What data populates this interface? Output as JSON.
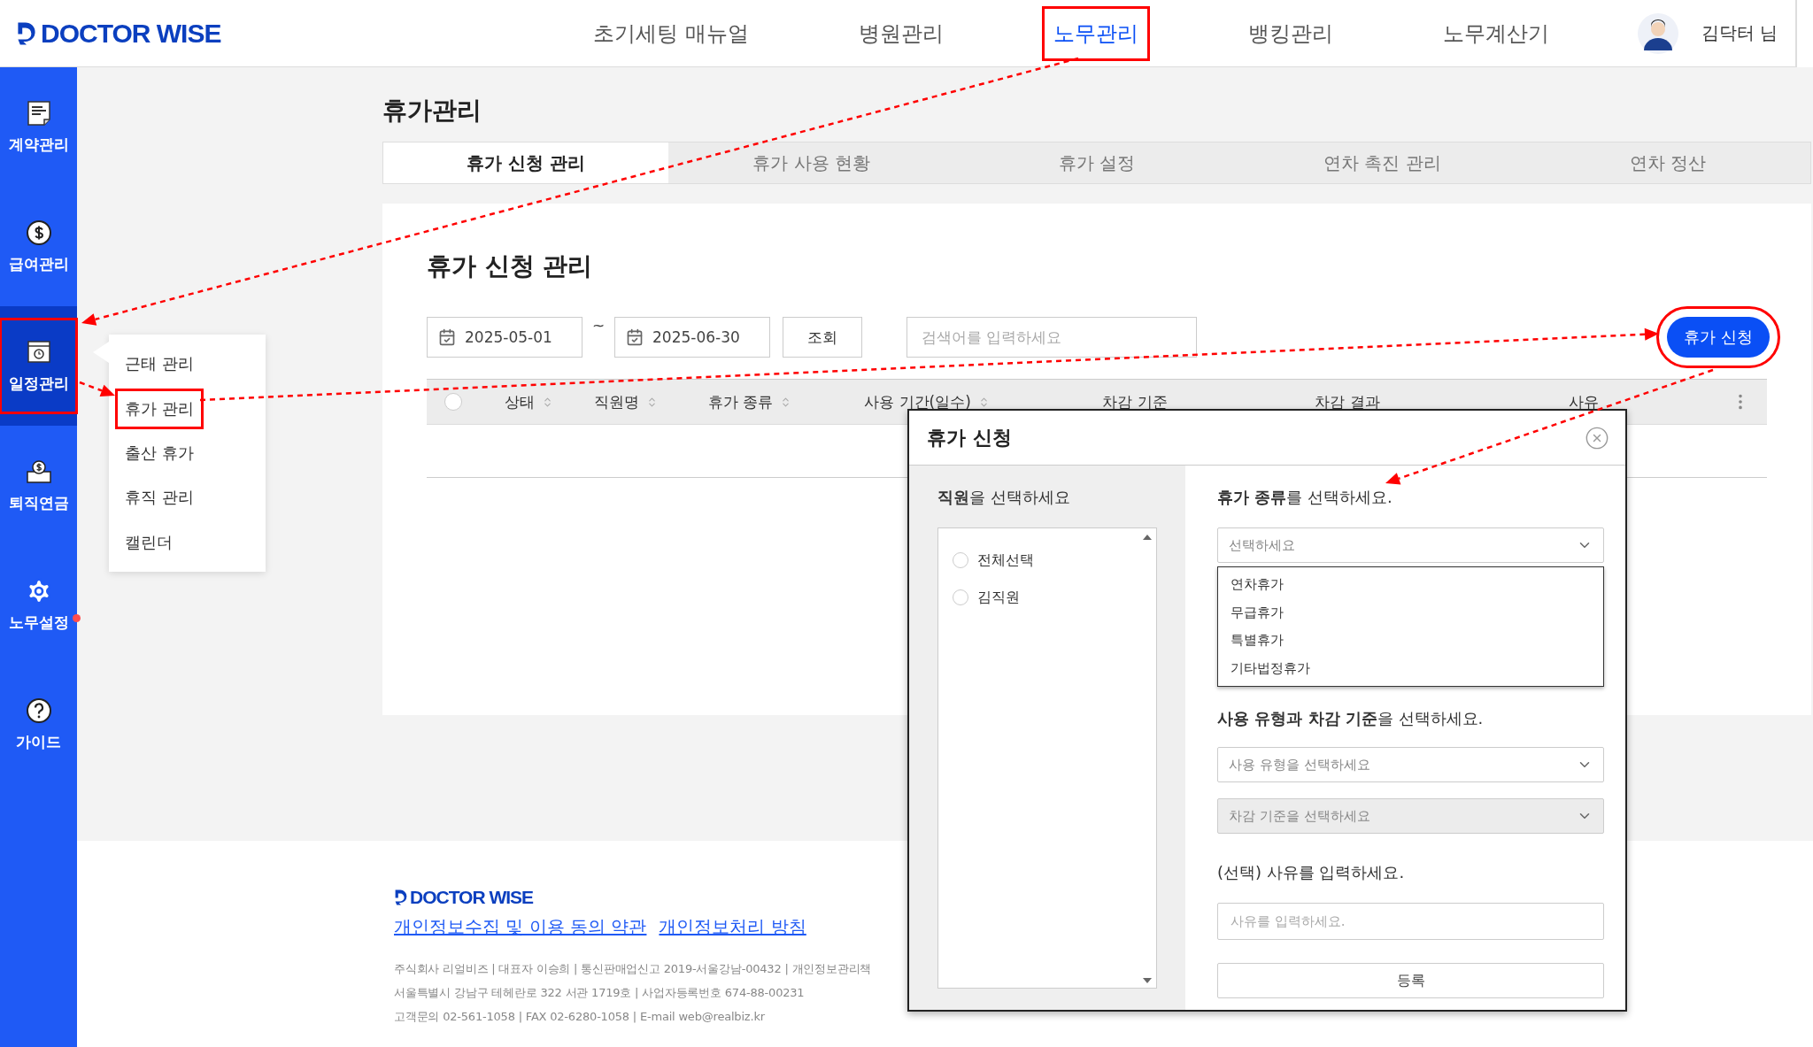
{
  "header": {
    "logo": "DOCTOR WISE",
    "user": "김닥터 님",
    "nav": [
      {
        "label": "초기세팅 매뉴얼",
        "selected": false,
        "highlighted": false
      },
      {
        "label": "병원관리",
        "selected": false,
        "highlighted": false
      },
      {
        "label": "노무관리",
        "selected": true,
        "highlighted": true
      },
      {
        "label": "뱅킹관리",
        "selected": false,
        "highlighted": false
      },
      {
        "label": "노무계산기",
        "selected": false,
        "highlighted": false
      }
    ]
  },
  "sidebar": {
    "items": [
      {
        "label": "계약관리",
        "selected": false,
        "highlighted": false,
        "notification": false
      },
      {
        "label": "급여관리",
        "selected": false,
        "highlighted": false,
        "notification": false
      },
      {
        "label": "일정관리",
        "selected": true,
        "highlighted": true,
        "notification": false
      },
      {
        "label": "퇴직연금",
        "selected": false,
        "highlighted": false,
        "notification": false
      },
      {
        "label": "노무설정",
        "selected": false,
        "highlighted": false,
        "notification": true
      },
      {
        "label": "가이드",
        "selected": false,
        "highlighted": false,
        "notification": false
      }
    ]
  },
  "submenu": {
    "items": [
      {
        "label": "근태 관리",
        "highlighted": false
      },
      {
        "label": "휴가 관리",
        "highlighted": true
      },
      {
        "label": "출산 휴가",
        "highlighted": false
      },
      {
        "label": "휴직 관리",
        "highlighted": false
      },
      {
        "label": "캘린더",
        "highlighted": false
      }
    ]
  },
  "page": {
    "title": "휴가관리",
    "tabs": [
      {
        "label": "휴가 신청 관리",
        "selected": true
      },
      {
        "label": "휴가 사용 현황",
        "selected": false
      },
      {
        "label": "휴가 설정",
        "selected": false
      },
      {
        "label": "연차 촉진 관리",
        "selected": false
      },
      {
        "label": "연차 정산",
        "selected": false
      }
    ]
  },
  "panel": {
    "title": "휴가 신청 관리",
    "start_date": "2025-05-01",
    "range_separator": "~",
    "end_date": "2025-06-30",
    "search_button": "조회",
    "search": {
      "placeholder": "검색어를 입력하세요"
    },
    "apply_button": {
      "label": "휴가 신청",
      "highlighted": true
    },
    "table": {
      "select_all": {
        "checked": false
      },
      "columns": [
        {
          "label": "상태",
          "sortable": true
        },
        {
          "label": "직원명",
          "sortable": true
        },
        {
          "label": "휴가 종류",
          "sortable": true
        },
        {
          "label": "사용 기간(일수)",
          "sortable": true
        },
        {
          "label": "차감 기준",
          "sortable": false
        },
        {
          "label": "차감 결과",
          "sortable": false
        },
        {
          "label": "사유",
          "sortable": false
        }
      ]
    }
  },
  "modal": {
    "title": "휴가 신청",
    "employee_label": "**직원**을 선택하세요",
    "employees": [
      {
        "label": "전체선택",
        "checked": false
      },
      {
        "label": "김직원",
        "checked": false
      }
    ],
    "leave_type_label": "**휴가 종류**를 선택하세요.",
    "leave_type_select": {
      "value": "선택하세요",
      "disabled": false
    },
    "leave_type_options": [
      "연차휴가",
      "무급휴가",
      "특별휴가",
      "기타법정휴가"
    ],
    "usage_label": "**사용 유형과 차감 기준**을 선택하세요.",
    "usage_select": {
      "value": "사용 유형을 선택하세요",
      "disabled": false
    },
    "deduction_select": {
      "value": "차감 기준을 선택하세요",
      "disabled": true
    },
    "reason_label": "(선택) 사유를 입력하세요.",
    "reason_input": {
      "placeholder": "사유를 입력하세요."
    },
    "submit_button": "등록"
  },
  "footer": {
    "logo": "DOCTOR WISE",
    "links": [
      "개인정보수집 및 이용 동의 약관",
      "개인정보처리 방침"
    ],
    "lines": [
      "주식회사 리얼비즈 | 대표자 이승희 | 통신판매업신고 2019-서울강남-00432 | 개인정보관리책",
      "서울특별시 강남구 테헤란로 322 서관 1719호 | 사업자등록번호 674-88-00231",
      "고객문의 02-561-1058 | FAX 02-6280-1058 | E-mail web@realbiz.kr"
    ]
  }
}
